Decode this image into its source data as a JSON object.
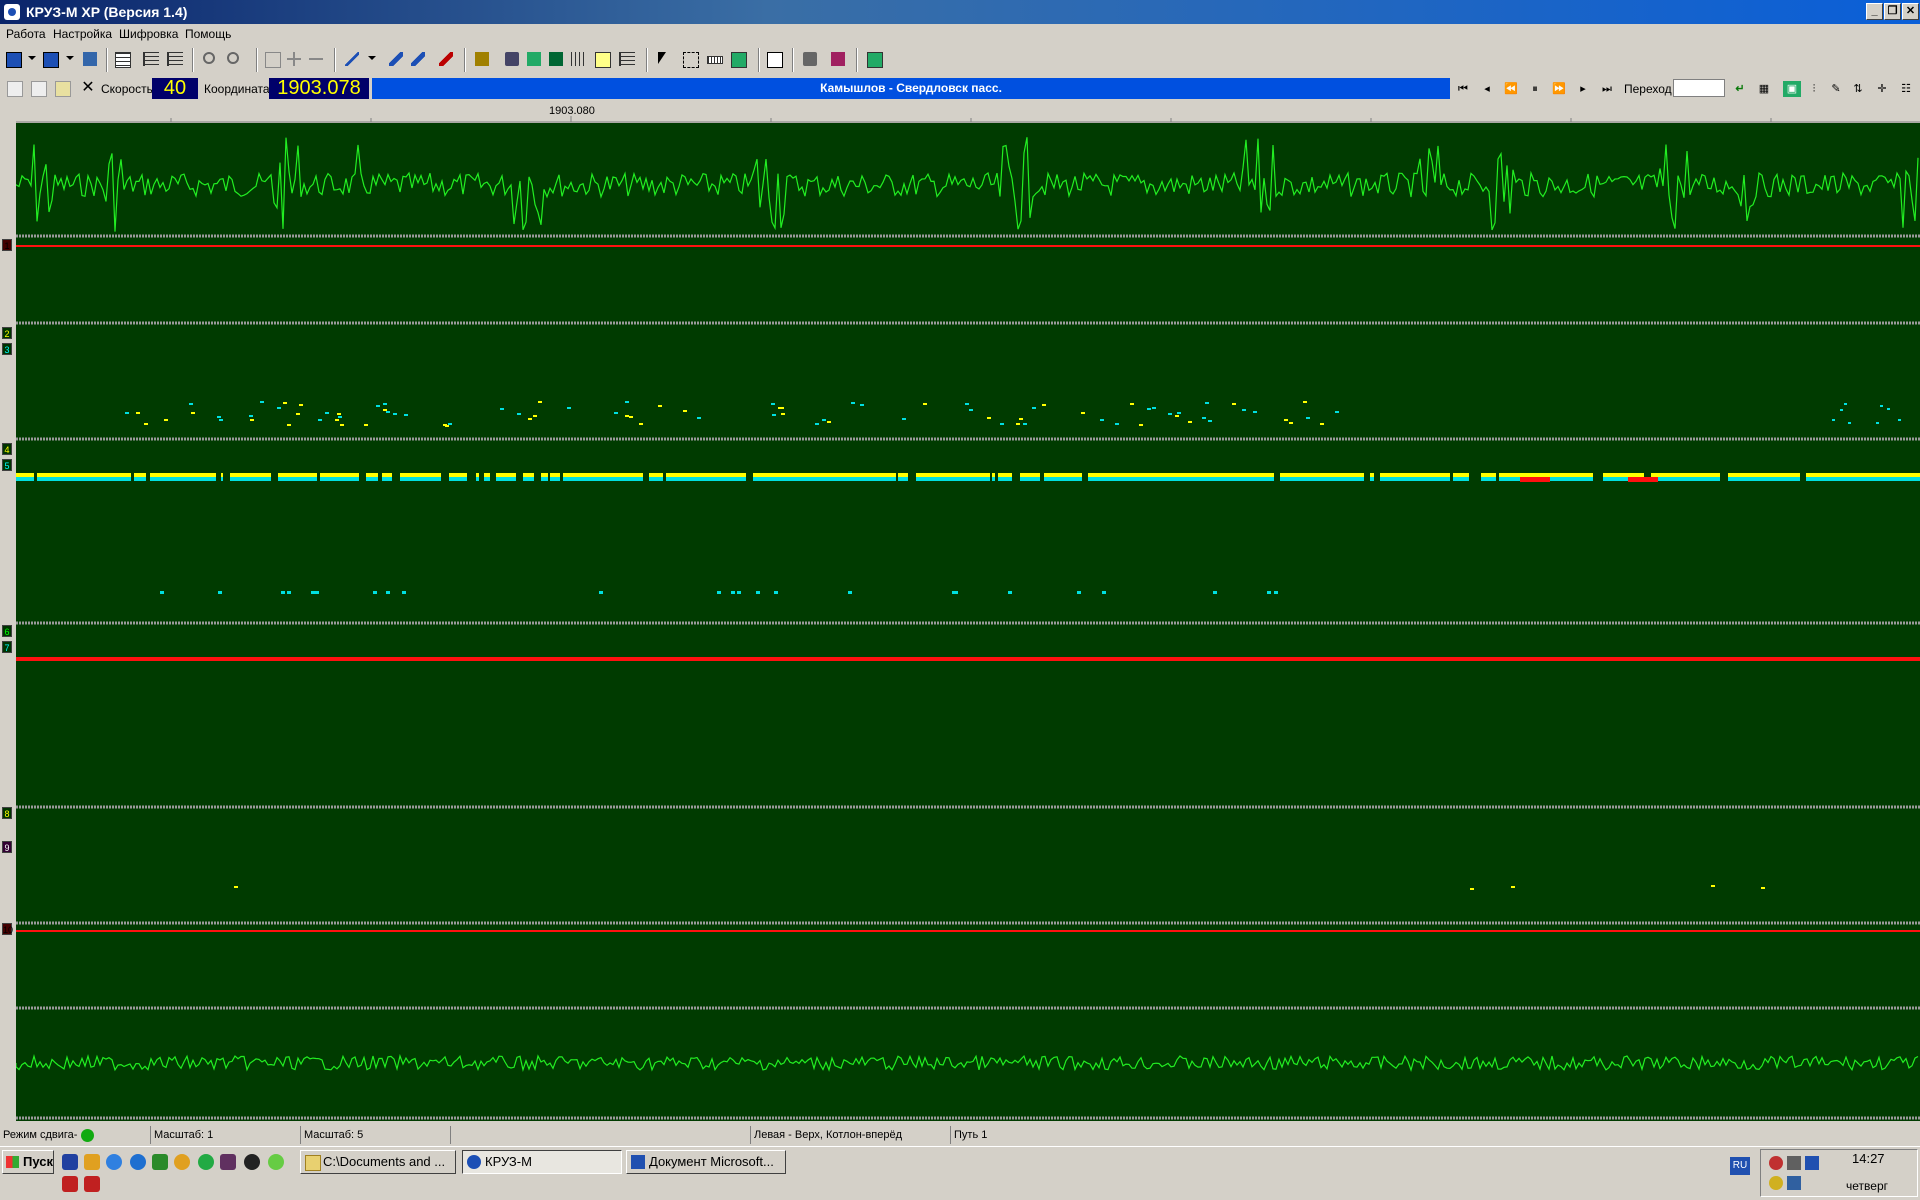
{
  "window": {
    "title": "КРУЗ-М XP (Версия 1.4)"
  },
  "menu": [
    "Работа",
    "Настройка",
    "Шифровка",
    "Помощь"
  ],
  "info": {
    "speed_label": "Скорость",
    "speed_value": "40",
    "coord_label": "Координата",
    "coord_value": "1903.078",
    "route": "Камышлов - Свердловск пасс.",
    "goto_label": "Переход",
    "goto_value": ""
  },
  "ruler": {
    "marker": "1903.080"
  },
  "channels": {
    "marks": [
      "1",
      "2",
      "3",
      "4",
      "5",
      "6",
      "7",
      "8",
      "9",
      "10"
    ],
    "colors": {
      "background": "#003b00",
      "wave": "#22ee22",
      "red": "#ff1010",
      "cyan": "#00e0e0",
      "yellow": "#ffff00",
      "separator": "#9a9a9a"
    }
  },
  "status": {
    "mode": "Режим сдвига-",
    "scale1": "Масштаб: 1",
    "scale2": "Масштаб: 5",
    "orientation": "Левая - Верх, Котлон-вперёд",
    "track": "Путь 1"
  },
  "taskbar": {
    "start": "Пуск",
    "tasks": [
      "C:\\Documents and ...",
      "КРУЗ-М",
      "Документ Microsoft..."
    ],
    "lang": "RU",
    "time": "14:27",
    "day": "четверг"
  }
}
